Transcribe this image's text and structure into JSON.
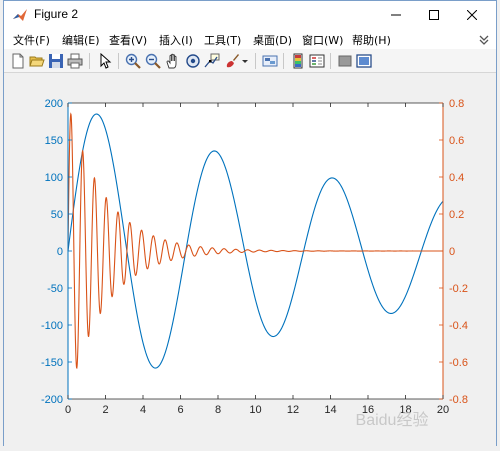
{
  "window": {
    "title": "Figure 2"
  },
  "menu": [
    "文件(F)",
    "编辑(E)",
    "查看(V)",
    "插入(I)",
    "工具(T)",
    "桌面(D)",
    "窗口(W)",
    "帮助(H)"
  ],
  "toolbar_icons": [
    "new-figure-icon",
    "open-file-icon",
    "save-icon",
    "print-icon",
    "select-arrow-icon",
    "zoom-in-icon",
    "zoom-out-icon",
    "pan-hand-icon",
    "rotate-3d-icon",
    "data-cursor-icon",
    "brush-icon",
    "brush-dropdown-icon",
    "link-plot-icon",
    "insert-colorbar-icon",
    "insert-legend-icon",
    "hide-plot-tools-icon",
    "show-plot-tools-icon"
  ],
  "colors": {
    "left_axis": "#0072BD",
    "right_axis": "#D95319"
  },
  "chart_data": {
    "type": "line",
    "x_ticks": [
      "0",
      "2",
      "4",
      "6",
      "8",
      "10",
      "12",
      "14",
      "16",
      "18",
      "20"
    ],
    "y_left_ticks": [
      "200",
      "150",
      "100",
      "50",
      "0",
      "-50",
      "-100",
      "-150",
      "-200"
    ],
    "y_right_ticks": [
      "0.8",
      "0.6",
      "0.4",
      "0.2",
      "0",
      "-0.2",
      "-0.4",
      "-0.6",
      "-0.8"
    ],
    "xlim": [
      0,
      20
    ],
    "ylim_left": [
      -200,
      200
    ],
    "ylim_right": [
      -0.8,
      0.8
    ],
    "grid": false,
    "series": [
      {
        "axis": "left",
        "color": "#0072BD",
        "formula": "200*exp(-0.05x)*sin(x)",
        "x_range": [
          0,
          20
        ]
      },
      {
        "axis": "right",
        "color": "#D95319",
        "formula": "0.8*exp(-0.5x)*sin(10x)",
        "x_range": [
          0,
          20
        ]
      }
    ],
    "watermark": "Baidu经验"
  }
}
